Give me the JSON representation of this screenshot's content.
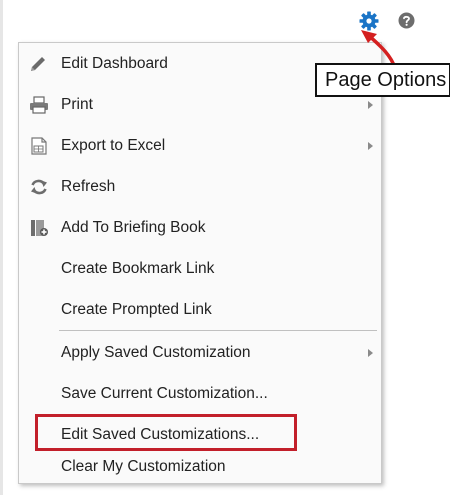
{
  "toolbar": {
    "gear_icon": "gear-icon",
    "help_icon": "help-icon"
  },
  "tooltip": {
    "text": "Page Options"
  },
  "menu": {
    "items": [
      {
        "label": "Edit Dashboard",
        "icon": "pencil-icon"
      },
      {
        "label": "Print",
        "icon": "printer-icon",
        "submenu": true
      },
      {
        "label": "Export to Excel",
        "icon": "excel-export-icon",
        "submenu": true
      },
      {
        "label": "Refresh",
        "icon": "refresh-icon"
      },
      {
        "label": "Add To Briefing Book",
        "icon": "briefing-book-icon"
      },
      {
        "label": "Create Bookmark Link"
      },
      {
        "label": "Create Prompted Link"
      },
      {
        "label": "Apply Saved Customization",
        "submenu": true
      },
      {
        "label": "Save Current Customization..."
      },
      {
        "label": "Edit Saved Customizations...",
        "highlighted": true
      },
      {
        "label": "Clear My Customization"
      }
    ]
  },
  "colors": {
    "gear": "#1a74c6",
    "highlight": "#c21f2a",
    "annotation_arrow": "#d42020"
  }
}
